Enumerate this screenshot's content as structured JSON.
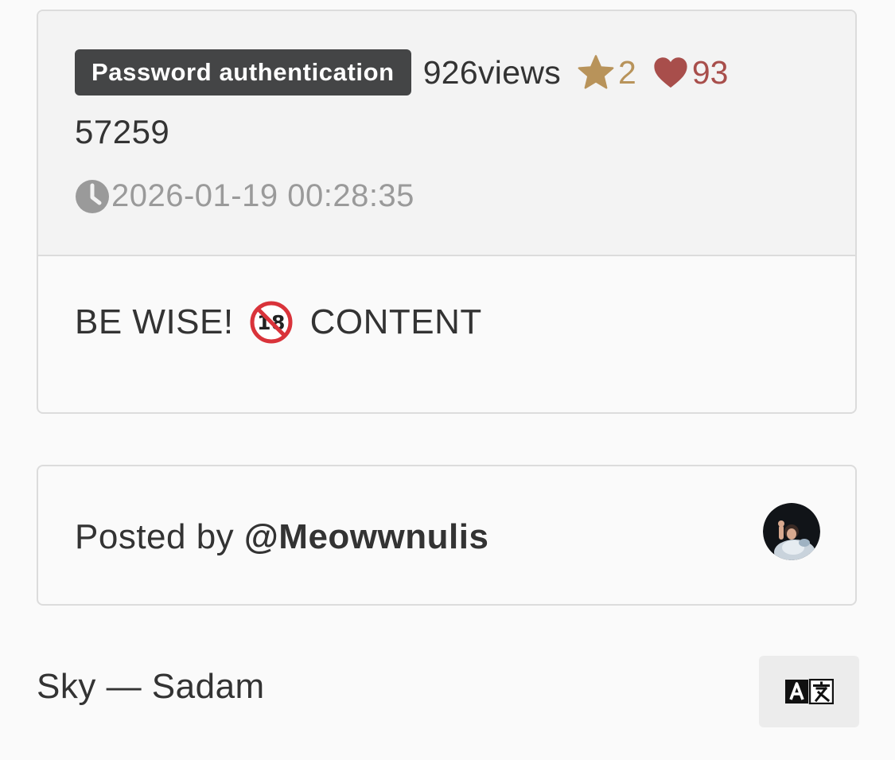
{
  "post": {
    "auth_badge": "Password authentication",
    "views": "926views",
    "stars": "2",
    "likes": "93",
    "number": "57259",
    "timestamp": "2026-01-19 00:28:35",
    "body_before": "BE WISE!",
    "body_after": "CONTENT"
  },
  "author": {
    "prefix": "Posted by ",
    "handle": "@Meowwnulis"
  },
  "footer": {
    "text": "Sky — Sadam"
  },
  "icons": {
    "star": "star-icon",
    "heart": "heart-icon",
    "clock": "clock-icon",
    "no18": "no-one-under-eighteen-icon",
    "translate": "translate-icon"
  },
  "colors": {
    "badge_bg": "#444546",
    "star": "#b8935a",
    "heart": "#a84e4b",
    "timestamp": "#9a9a9a",
    "no18_red": "#d9333a"
  }
}
